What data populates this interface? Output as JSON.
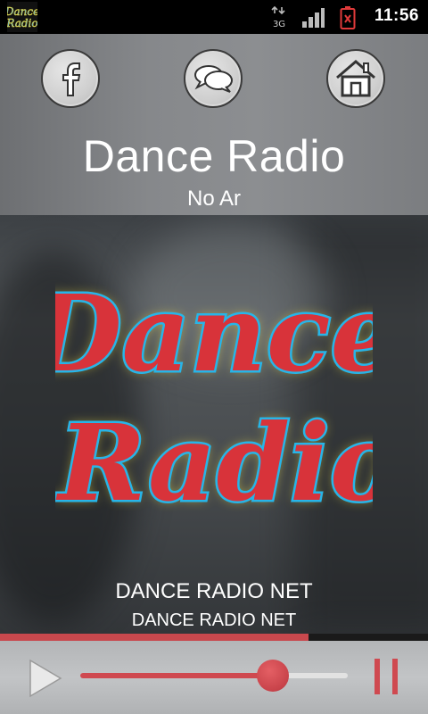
{
  "status_bar": {
    "time": "11:56",
    "network_label": "3G",
    "icons": [
      "app-icon",
      "network-3g-icon",
      "signal-icon",
      "battery-alert-icon"
    ],
    "battery_color": "#e03a3a"
  },
  "header": {
    "buttons": [
      {
        "name": "facebook",
        "icon": "facebook-icon"
      },
      {
        "name": "chat",
        "icon": "chat-bubbles-icon"
      },
      {
        "name": "home",
        "icon": "home-icon"
      }
    ],
    "station_name": "Dance Radio",
    "station_status": "No Ar"
  },
  "artwork": {
    "logo_text_line1": "Dance",
    "logo_text_line2": "Radio",
    "artist": "DANCE RADIO NET",
    "title": "DANCE RADIO NET"
  },
  "player": {
    "progress": 0.72,
    "volume": 0.72,
    "accent_color": "#c8484d",
    "play_icon": "play-icon",
    "pause_icon": "pause-icon"
  }
}
